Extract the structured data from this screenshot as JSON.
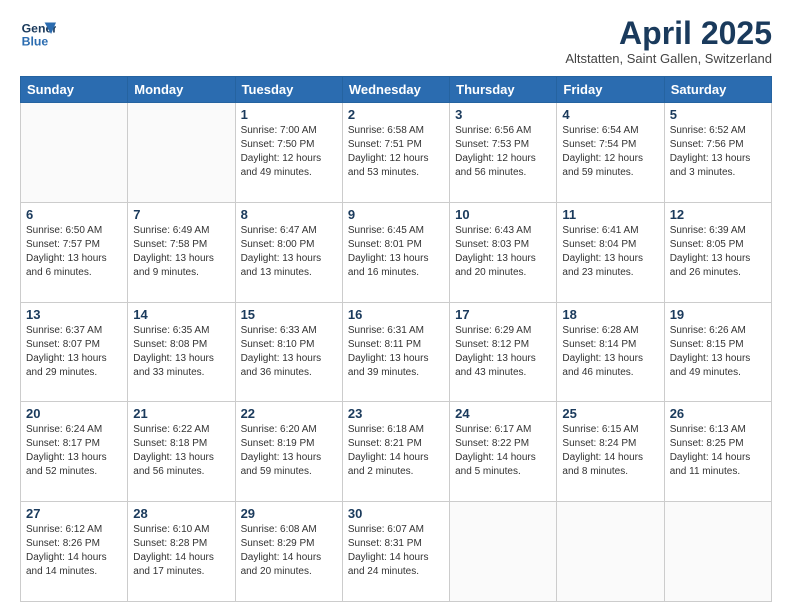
{
  "header": {
    "logo_line1": "General",
    "logo_line2": "Blue",
    "month": "April 2025",
    "location": "Altstatten, Saint Gallen, Switzerland"
  },
  "days_of_week": [
    "Sunday",
    "Monday",
    "Tuesday",
    "Wednesday",
    "Thursday",
    "Friday",
    "Saturday"
  ],
  "weeks": [
    [
      {
        "num": "",
        "sunrise": "",
        "sunset": "",
        "daylight": ""
      },
      {
        "num": "",
        "sunrise": "",
        "sunset": "",
        "daylight": ""
      },
      {
        "num": "1",
        "sunrise": "Sunrise: 7:00 AM",
        "sunset": "Sunset: 7:50 PM",
        "daylight": "Daylight: 12 hours and 49 minutes."
      },
      {
        "num": "2",
        "sunrise": "Sunrise: 6:58 AM",
        "sunset": "Sunset: 7:51 PM",
        "daylight": "Daylight: 12 hours and 53 minutes."
      },
      {
        "num": "3",
        "sunrise": "Sunrise: 6:56 AM",
        "sunset": "Sunset: 7:53 PM",
        "daylight": "Daylight: 12 hours and 56 minutes."
      },
      {
        "num": "4",
        "sunrise": "Sunrise: 6:54 AM",
        "sunset": "Sunset: 7:54 PM",
        "daylight": "Daylight: 12 hours and 59 minutes."
      },
      {
        "num": "5",
        "sunrise": "Sunrise: 6:52 AM",
        "sunset": "Sunset: 7:56 PM",
        "daylight": "Daylight: 13 hours and 3 minutes."
      }
    ],
    [
      {
        "num": "6",
        "sunrise": "Sunrise: 6:50 AM",
        "sunset": "Sunset: 7:57 PM",
        "daylight": "Daylight: 13 hours and 6 minutes."
      },
      {
        "num": "7",
        "sunrise": "Sunrise: 6:49 AM",
        "sunset": "Sunset: 7:58 PM",
        "daylight": "Daylight: 13 hours and 9 minutes."
      },
      {
        "num": "8",
        "sunrise": "Sunrise: 6:47 AM",
        "sunset": "Sunset: 8:00 PM",
        "daylight": "Daylight: 13 hours and 13 minutes."
      },
      {
        "num": "9",
        "sunrise": "Sunrise: 6:45 AM",
        "sunset": "Sunset: 8:01 PM",
        "daylight": "Daylight: 13 hours and 16 minutes."
      },
      {
        "num": "10",
        "sunrise": "Sunrise: 6:43 AM",
        "sunset": "Sunset: 8:03 PM",
        "daylight": "Daylight: 13 hours and 20 minutes."
      },
      {
        "num": "11",
        "sunrise": "Sunrise: 6:41 AM",
        "sunset": "Sunset: 8:04 PM",
        "daylight": "Daylight: 13 hours and 23 minutes."
      },
      {
        "num": "12",
        "sunrise": "Sunrise: 6:39 AM",
        "sunset": "Sunset: 8:05 PM",
        "daylight": "Daylight: 13 hours and 26 minutes."
      }
    ],
    [
      {
        "num": "13",
        "sunrise": "Sunrise: 6:37 AM",
        "sunset": "Sunset: 8:07 PM",
        "daylight": "Daylight: 13 hours and 29 minutes."
      },
      {
        "num": "14",
        "sunrise": "Sunrise: 6:35 AM",
        "sunset": "Sunset: 8:08 PM",
        "daylight": "Daylight: 13 hours and 33 minutes."
      },
      {
        "num": "15",
        "sunrise": "Sunrise: 6:33 AM",
        "sunset": "Sunset: 8:10 PM",
        "daylight": "Daylight: 13 hours and 36 minutes."
      },
      {
        "num": "16",
        "sunrise": "Sunrise: 6:31 AM",
        "sunset": "Sunset: 8:11 PM",
        "daylight": "Daylight: 13 hours and 39 minutes."
      },
      {
        "num": "17",
        "sunrise": "Sunrise: 6:29 AM",
        "sunset": "Sunset: 8:12 PM",
        "daylight": "Daylight: 13 hours and 43 minutes."
      },
      {
        "num": "18",
        "sunrise": "Sunrise: 6:28 AM",
        "sunset": "Sunset: 8:14 PM",
        "daylight": "Daylight: 13 hours and 46 minutes."
      },
      {
        "num": "19",
        "sunrise": "Sunrise: 6:26 AM",
        "sunset": "Sunset: 8:15 PM",
        "daylight": "Daylight: 13 hours and 49 minutes."
      }
    ],
    [
      {
        "num": "20",
        "sunrise": "Sunrise: 6:24 AM",
        "sunset": "Sunset: 8:17 PM",
        "daylight": "Daylight: 13 hours and 52 minutes."
      },
      {
        "num": "21",
        "sunrise": "Sunrise: 6:22 AM",
        "sunset": "Sunset: 8:18 PM",
        "daylight": "Daylight: 13 hours and 56 minutes."
      },
      {
        "num": "22",
        "sunrise": "Sunrise: 6:20 AM",
        "sunset": "Sunset: 8:19 PM",
        "daylight": "Daylight: 13 hours and 59 minutes."
      },
      {
        "num": "23",
        "sunrise": "Sunrise: 6:18 AM",
        "sunset": "Sunset: 8:21 PM",
        "daylight": "Daylight: 14 hours and 2 minutes."
      },
      {
        "num": "24",
        "sunrise": "Sunrise: 6:17 AM",
        "sunset": "Sunset: 8:22 PM",
        "daylight": "Daylight: 14 hours and 5 minutes."
      },
      {
        "num": "25",
        "sunrise": "Sunrise: 6:15 AM",
        "sunset": "Sunset: 8:24 PM",
        "daylight": "Daylight: 14 hours and 8 minutes."
      },
      {
        "num": "26",
        "sunrise": "Sunrise: 6:13 AM",
        "sunset": "Sunset: 8:25 PM",
        "daylight": "Daylight: 14 hours and 11 minutes."
      }
    ],
    [
      {
        "num": "27",
        "sunrise": "Sunrise: 6:12 AM",
        "sunset": "Sunset: 8:26 PM",
        "daylight": "Daylight: 14 hours and 14 minutes."
      },
      {
        "num": "28",
        "sunrise": "Sunrise: 6:10 AM",
        "sunset": "Sunset: 8:28 PM",
        "daylight": "Daylight: 14 hours and 17 minutes."
      },
      {
        "num": "29",
        "sunrise": "Sunrise: 6:08 AM",
        "sunset": "Sunset: 8:29 PM",
        "daylight": "Daylight: 14 hours and 20 minutes."
      },
      {
        "num": "30",
        "sunrise": "Sunrise: 6:07 AM",
        "sunset": "Sunset: 8:31 PM",
        "daylight": "Daylight: 14 hours and 24 minutes."
      },
      {
        "num": "",
        "sunrise": "",
        "sunset": "",
        "daylight": ""
      },
      {
        "num": "",
        "sunrise": "",
        "sunset": "",
        "daylight": ""
      },
      {
        "num": "",
        "sunrise": "",
        "sunset": "",
        "daylight": ""
      }
    ]
  ]
}
